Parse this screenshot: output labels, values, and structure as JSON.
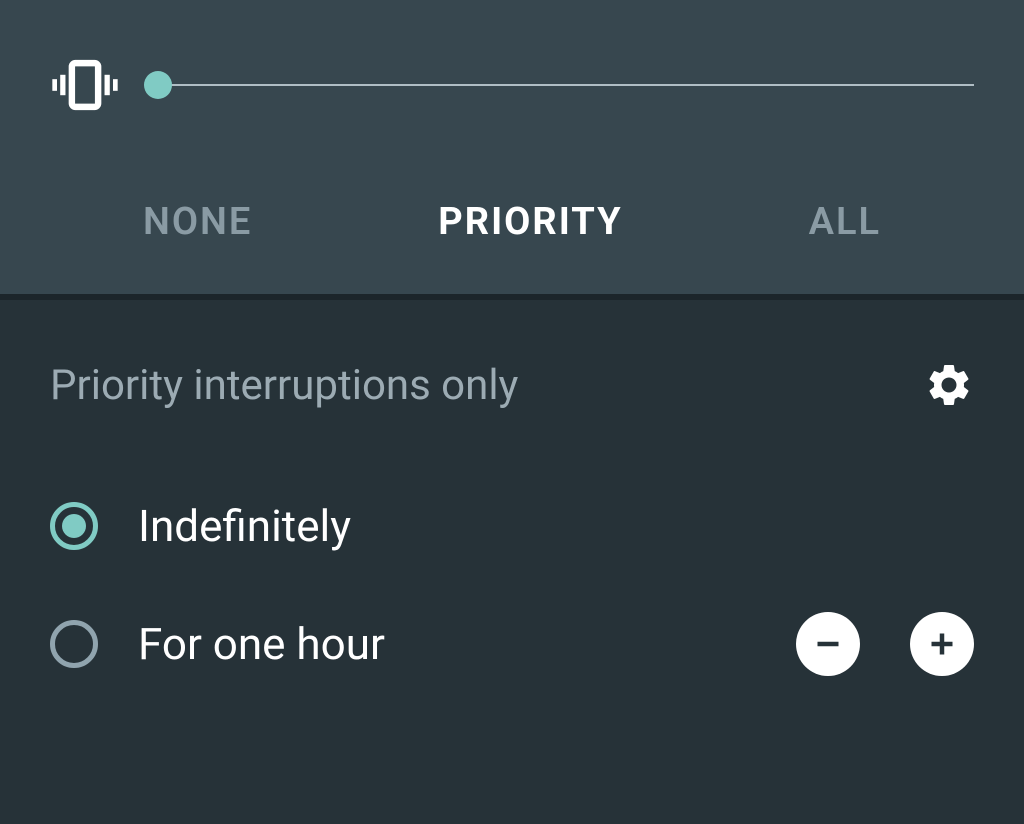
{
  "tabs": {
    "none": "NONE",
    "priority": "PRIORITY",
    "all": "ALL",
    "active": "priority"
  },
  "section": {
    "title": "Priority interruptions only"
  },
  "options": {
    "indefinitely": {
      "label": "Indefinitely",
      "selected": true
    },
    "duration": {
      "label": "For one hour",
      "selected": false
    }
  },
  "slider": {
    "value": 0
  },
  "colors": {
    "accent": "#80CBC4",
    "bg_top": "#37474F",
    "bg_content": "#263238",
    "text_muted": "#8A9BA4",
    "text_light": "#FFFFFF"
  }
}
